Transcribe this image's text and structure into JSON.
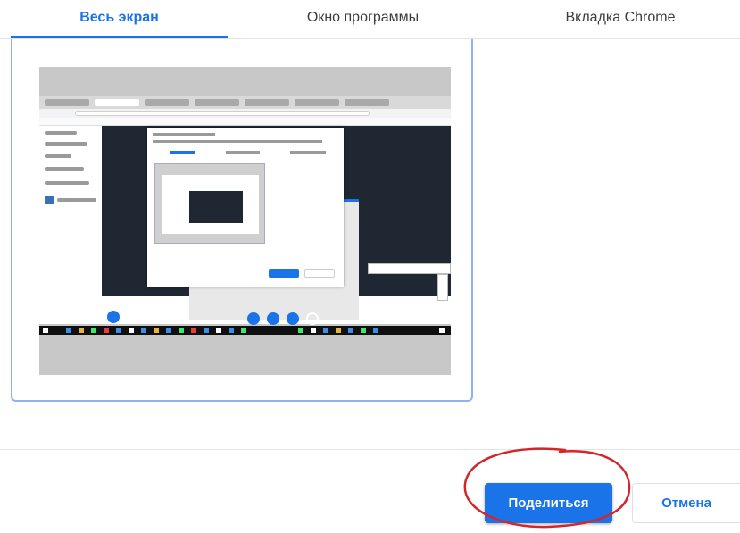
{
  "tabs": [
    {
      "label": "Весь экран",
      "active": true
    },
    {
      "label": "Окно программы",
      "active": false
    },
    {
      "label": "Вкладка Chrome",
      "active": false
    }
  ],
  "actions": {
    "share_label": "Поделиться",
    "cancel_label": "Отмена"
  },
  "colors": {
    "accent": "#1a73e8",
    "selection_border": "#8ab4f8",
    "annotation": "#d4262a"
  }
}
